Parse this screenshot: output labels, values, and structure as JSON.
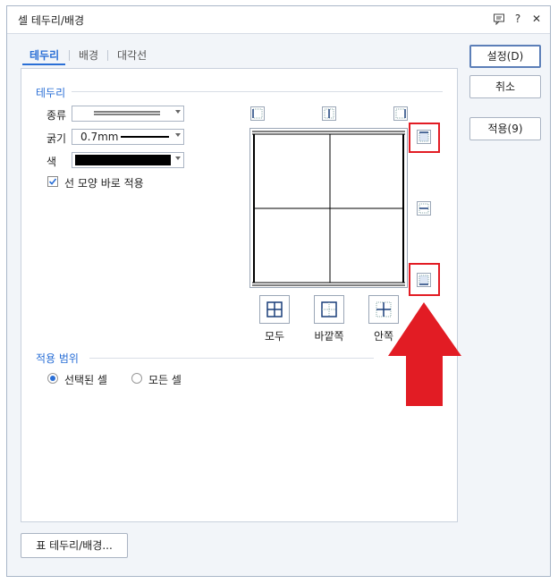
{
  "window": {
    "title": "셀 테두리/배경"
  },
  "tabs": [
    {
      "label": "테두리",
      "active": true
    },
    {
      "label": "배경",
      "active": false
    },
    {
      "label": "대각선",
      "active": false
    }
  ],
  "border_section": {
    "title": "테두리",
    "type_label": "종류",
    "thickness_label": "굵기",
    "thickness_value": "0.7mm",
    "color_label": "색",
    "color_value": "#000000",
    "apply_shape_checkbox": {
      "label": "선 모양 바로 적용",
      "checked": true
    }
  },
  "presets": [
    {
      "label": "모두"
    },
    {
      "label": "바깥쪽"
    },
    {
      "label": "안쪽"
    }
  ],
  "apply_range": {
    "title": "적용 범위",
    "options": [
      {
        "label": "선택된 셀",
        "selected": true
      },
      {
        "label": "모든 셀",
        "selected": false
      }
    ]
  },
  "buttons": {
    "ok": "설정(D)",
    "cancel": "취소",
    "apply": "적용(9)",
    "table_border": "표 테두리/배경..."
  },
  "annotation": {
    "highlight_color": "#e21c24"
  }
}
